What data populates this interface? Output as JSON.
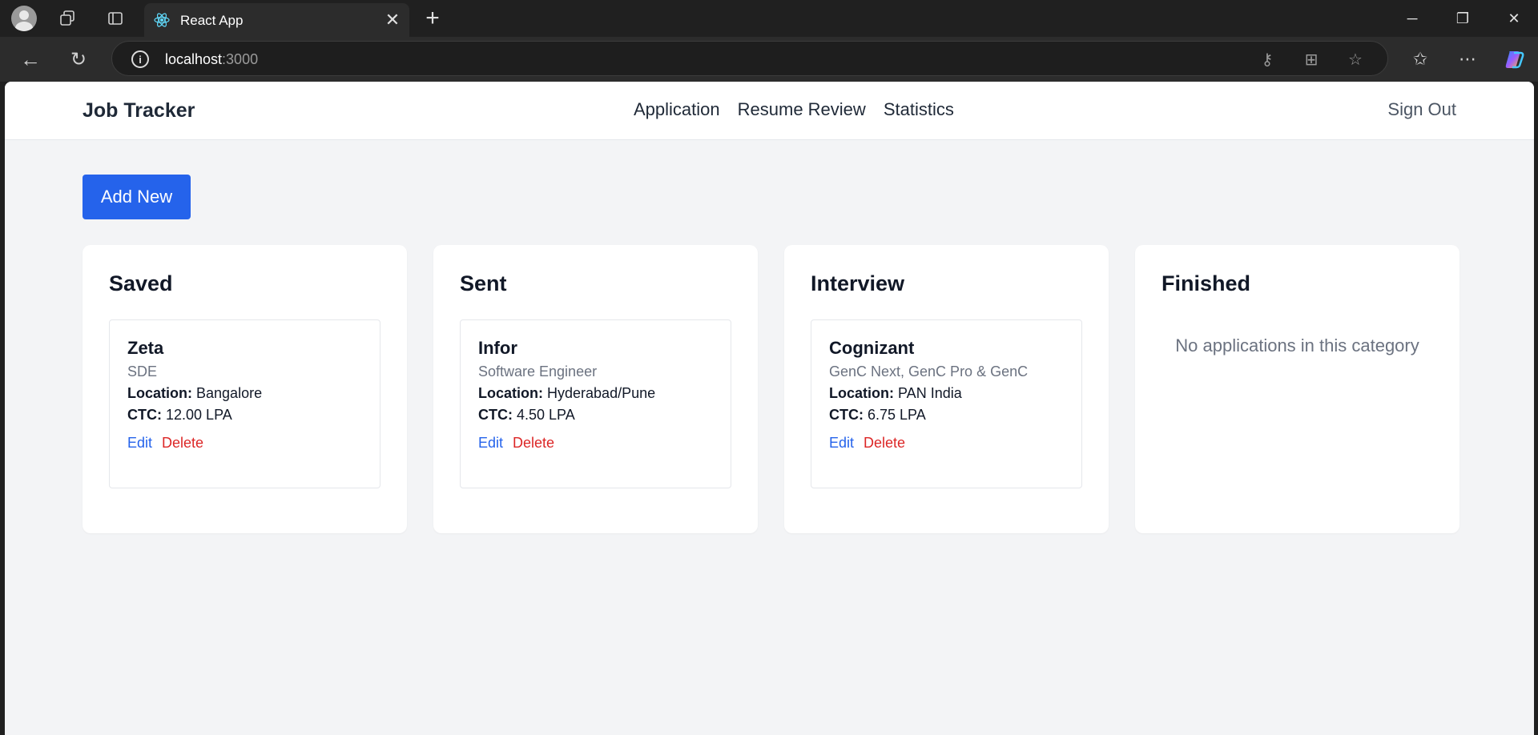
{
  "browser": {
    "tab_title": "React App",
    "url_host": "localhost",
    "url_port": ":3000"
  },
  "app": {
    "brand": "Job Tracker",
    "nav": [
      "Application",
      "Resume Review",
      "Statistics"
    ],
    "sign_out": "Sign Out",
    "add_new": "Add New",
    "colors": {
      "primary": "#2563eb",
      "danger": "#dc2626",
      "background": "#f3f4f6"
    }
  },
  "columns": [
    {
      "title": "Saved",
      "cards": [
        {
          "company": "Zeta",
          "role": "SDE",
          "location_label": "Location:",
          "location": "Bangalore",
          "ctc_label": "CTC:",
          "ctc": "12.00 LPA",
          "edit": "Edit",
          "delete": "Delete"
        }
      ]
    },
    {
      "title": "Sent",
      "cards": [
        {
          "company": "Infor",
          "role": "Software Engineer",
          "location_label": "Location:",
          "location": "Hyderabad/Pune",
          "ctc_label": "CTC:",
          "ctc": "4.50 LPA",
          "edit": "Edit",
          "delete": "Delete"
        }
      ]
    },
    {
      "title": "Interview",
      "cards": [
        {
          "company": "Cognizant",
          "role": "GenC Next, GenC Pro & GenC",
          "location_label": "Location:",
          "location": "PAN India",
          "ctc_label": "CTC:",
          "ctc": "6.75 LPA",
          "edit": "Edit",
          "delete": "Delete"
        }
      ]
    },
    {
      "title": "Finished",
      "empty_text": "No applications in this category"
    }
  ]
}
